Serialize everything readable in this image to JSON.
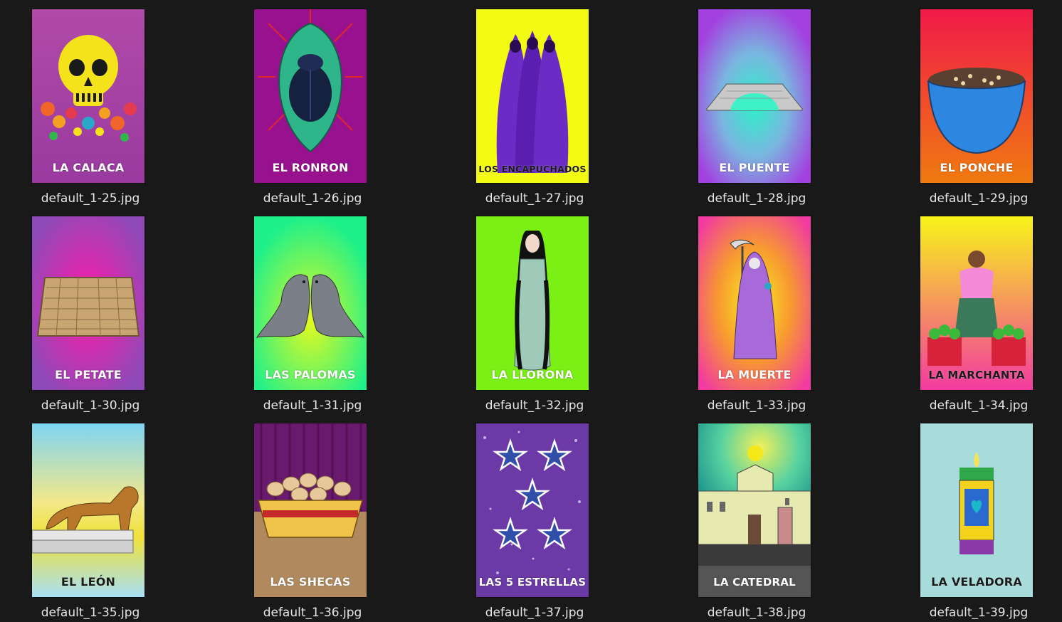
{
  "files": [
    {
      "filename": "default_1-25.jpg",
      "card_title": "LA CALACA",
      "icon": "skull-icon"
    },
    {
      "filename": "default_1-26.jpg",
      "card_title": "EL RONRON",
      "icon": "beetle-icon"
    },
    {
      "filename": "default_1-27.jpg",
      "card_title": "LOS ENCAPUCHADOS",
      "icon": "hooded-figures-icon"
    },
    {
      "filename": "default_1-28.jpg",
      "card_title": "EL PUENTE",
      "icon": "bridge-icon"
    },
    {
      "filename": "default_1-29.jpg",
      "card_title": "EL PONCHE",
      "icon": "pot-icon"
    },
    {
      "filename": "default_1-30.jpg",
      "card_title": "EL PETATE",
      "icon": "mat-icon"
    },
    {
      "filename": "default_1-31.jpg",
      "card_title": "LAS PALOMAS",
      "icon": "doves-icon"
    },
    {
      "filename": "default_1-32.jpg",
      "card_title": "LA LLORONA",
      "icon": "weeping-woman-icon"
    },
    {
      "filename": "default_1-33.jpg",
      "card_title": "LA MUERTE",
      "icon": "reaper-icon"
    },
    {
      "filename": "default_1-34.jpg",
      "card_title": "LA MARCHANTA",
      "icon": "vendor-woman-icon"
    },
    {
      "filename": "default_1-35.jpg",
      "card_title": "EL LEÓN",
      "icon": "lion-icon"
    },
    {
      "filename": "default_1-36.jpg",
      "card_title": "LAS SHECAS",
      "icon": "bread-basket-icon"
    },
    {
      "filename": "default_1-37.jpg",
      "card_title": "LAS 5 ESTRELLAS",
      "icon": "stars-icon"
    },
    {
      "filename": "default_1-38.jpg",
      "card_title": "LA CATEDRAL",
      "icon": "cathedral-icon"
    },
    {
      "filename": "default_1-39.jpg",
      "card_title": "LA VELADORA",
      "icon": "candle-icon"
    }
  ]
}
